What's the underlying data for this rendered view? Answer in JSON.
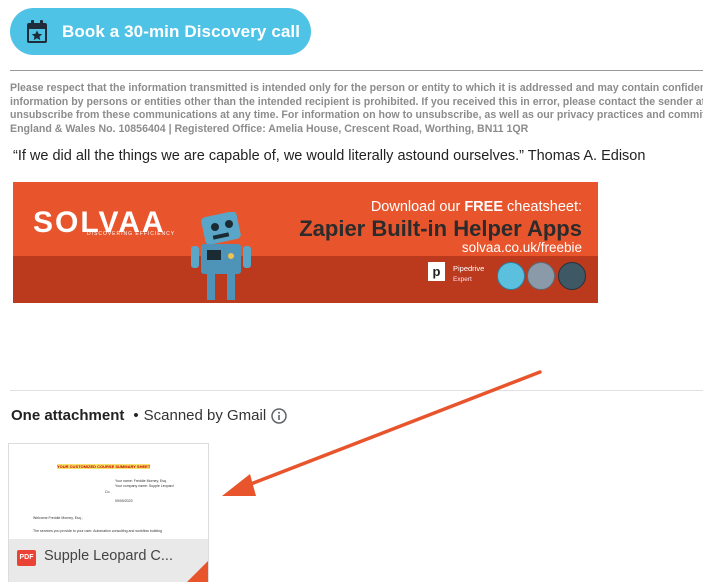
{
  "book_button": {
    "label": "Book a 30-min Discovery call",
    "color": "#4fc3e6",
    "icon": "calendar-star-icon"
  },
  "disclaimer_lines": [
    "Please respect that the information transmitted is intended only for the person or entity to which it is addressed and may contain confidentia",
    "information by persons or entities other than the intended recipient is prohibited. If you received this in error, please contact the sender at C",
    "unsubscribe from these communications at any time. For information on how to unsubscribe, as well as our privacy practices and commitme",
    "England & Wales No. 10856404 | Registered Office: Amelia House, Crescent Road, Worthing, BN11 1QR"
  ],
  "quote": "“If we did all the things we are capable of, we would literally astound ourselves.” Thomas A. Edison",
  "banner": {
    "logo": "SOLVAA",
    "tagline": "DISCOVERING EFFICIENCY",
    "download_prefix": "Download our ",
    "download_free": "FREE",
    "download_suffix": " cheatsheet:",
    "title": "Zapier Built-in Helper Apps",
    "url": "solvaa.co.uk/freebie",
    "partner_letter": "p",
    "partner_name": "Pipedrive",
    "partner_sub": "Expert",
    "colors": {
      "bg": "#e8552d",
      "band": "#bb3a1e",
      "title": "#2b2b2b"
    }
  },
  "attachments": {
    "title": "One attachment",
    "scanned": "Scanned by Gmail",
    "file": {
      "type_label": "PDF",
      "name": "Supple Leopard C...",
      "preview": {
        "heading": "YOUR CUSTOMIZED COURSE SUMMARY SHEET",
        "owner_line": "Your name: Freddie Morney, Esq.",
        "company_line": "Your company name: Supple Leopard",
        "co": "Co.",
        "date": "09/09/2023",
        "welcome": "Welcome Freddie Morney, Esq.,",
        "service_line": "The services you provide to your user: Automation consulting and workflow building"
      }
    }
  },
  "annotation": {
    "type": "arrow",
    "color": "#e8552d"
  }
}
